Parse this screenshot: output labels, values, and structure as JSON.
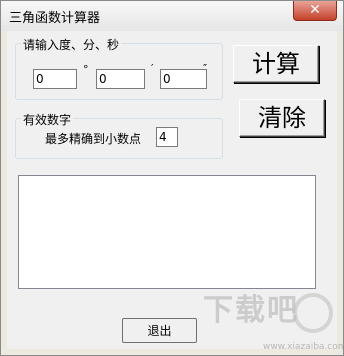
{
  "window": {
    "title": "三角函数计算器",
    "close_glyph": "✕"
  },
  "input_group": {
    "legend": "请输入度、分、秒",
    "degree_value": "0",
    "minute_value": "0",
    "second_value": "0",
    "degree_symbol": "°",
    "minute_symbol": "′",
    "second_symbol": "″"
  },
  "precision_group": {
    "legend": "有效数字",
    "label": "最多精确到小数点",
    "value": "4"
  },
  "buttons": {
    "calculate": "计算",
    "clear": "清除",
    "exit": "退出"
  },
  "output": {
    "text": ""
  },
  "watermark": {
    "text": "下载吧",
    "url": "www.xiazaiba.com"
  }
}
